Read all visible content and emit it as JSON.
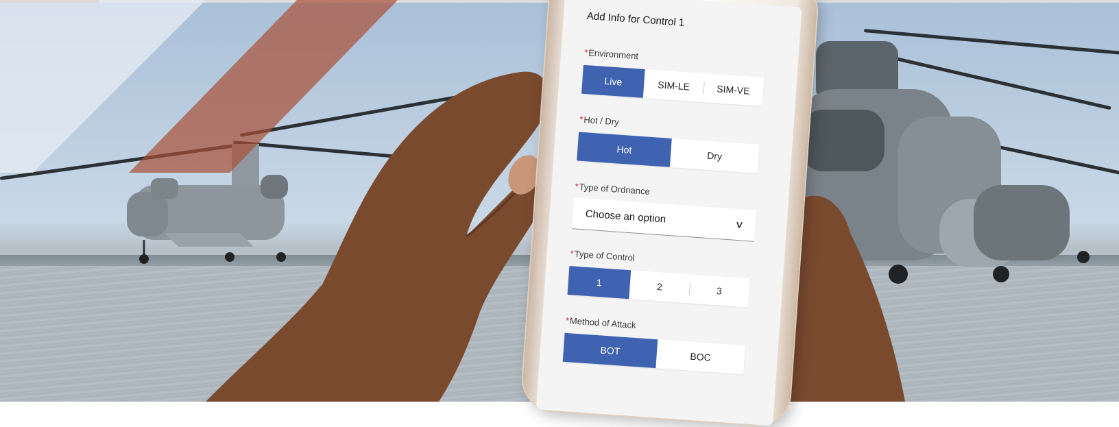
{
  "form": {
    "title": "Add Info for Control 1",
    "required_marker": "*",
    "environment": {
      "label": "Environment",
      "options": [
        "Live",
        "SIM-LE",
        "SIM-VE"
      ],
      "selected": "Live"
    },
    "hot_dry": {
      "label": "Hot / Dry",
      "options": [
        "Hot",
        "Dry"
      ],
      "selected": "Hot"
    },
    "ordnance": {
      "label": "Type of Ordnance",
      "value": "Choose an option",
      "chevron": "∨"
    },
    "control_type": {
      "label": "Type of Control",
      "options": [
        "1",
        "2",
        "3"
      ],
      "selected": "1"
    },
    "attack_method": {
      "label": "Method of Attack",
      "options": [
        "BOT",
        "BOC"
      ],
      "selected": "BOT"
    }
  },
  "colors": {
    "accent": "#3f63b1",
    "required": "#da1e28",
    "rust_stripe": "#aa5037"
  },
  "icons": {
    "dropdown": "chevron-down-icon"
  }
}
